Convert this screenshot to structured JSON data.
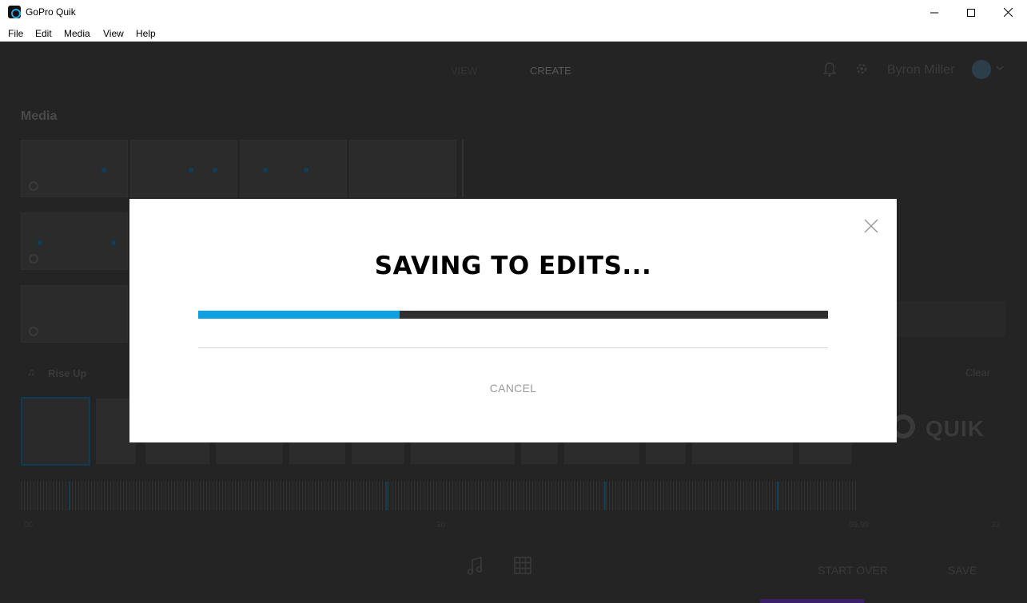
{
  "window": {
    "title": "GoPro Quik",
    "menu": [
      "File",
      "Edit",
      "Media",
      "View",
      "Help"
    ]
  },
  "nav": {
    "view_label": "VIEW",
    "create_label": "CREATE",
    "user_name": "Byron Miller"
  },
  "media": {
    "title": "Media"
  },
  "timeline": {
    "song_title": "Rise Up",
    "clear_label": "Clear",
    "ruler_marks": [
      "00",
      "30",
      "59.98",
      "33"
    ]
  },
  "branding": {
    "logo_text": "QUIK"
  },
  "actions": {
    "start_over_label": "START OVER",
    "save_label": "SAVE"
  },
  "modal": {
    "title": "SAVING TO EDITS...",
    "progress": 0.32,
    "cancel_label": "CANCEL"
  },
  "colors": {
    "accent": "#0ea0e2",
    "background": "#242424",
    "progress_track": "#303030"
  },
  "icons": [
    "app-icon",
    "minimize-icon",
    "maximize-icon",
    "close-icon",
    "bell-icon",
    "gear-icon",
    "avatar-icon",
    "chevron-down-icon",
    "music-icon",
    "grid-icon",
    "rotate-icon"
  ]
}
